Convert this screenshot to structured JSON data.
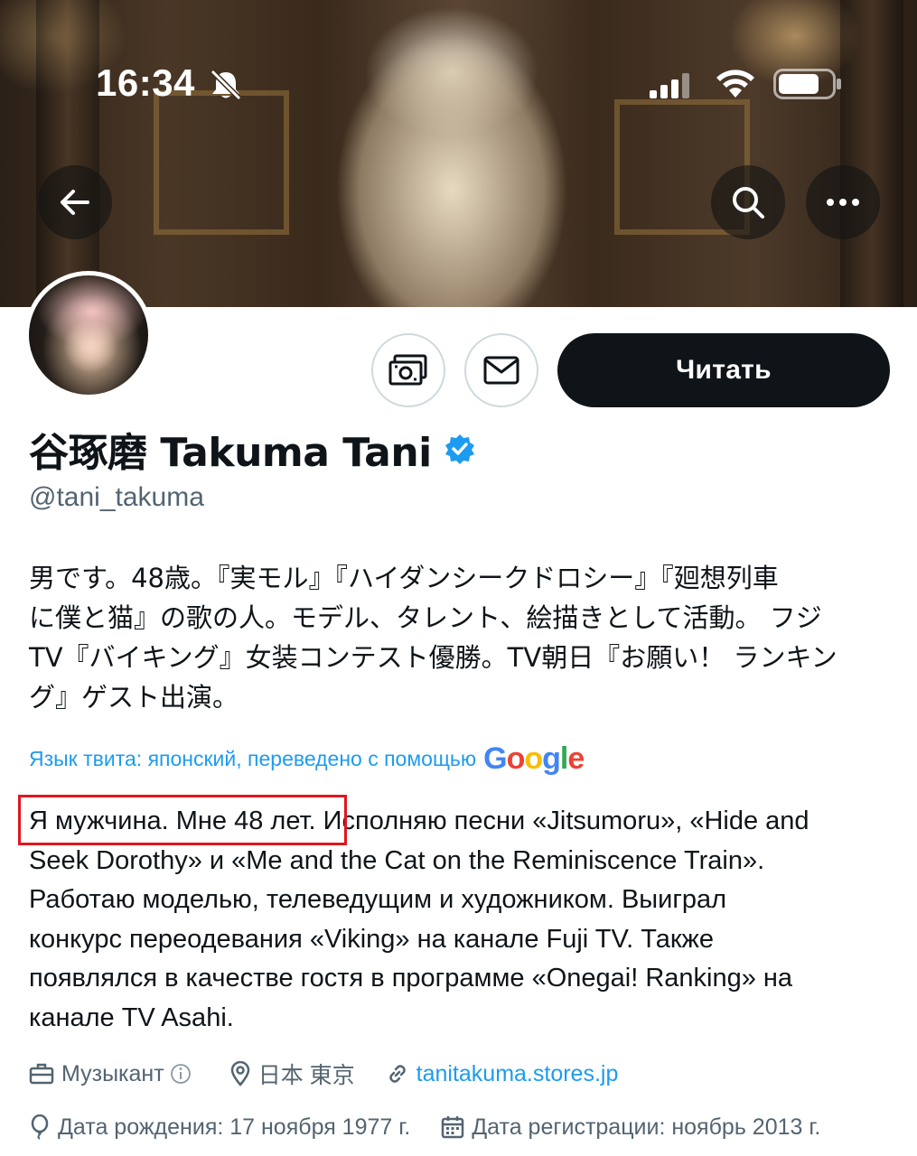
{
  "status_bar": {
    "time": "16:34",
    "icons": [
      "bell-slash-icon",
      "signal-icon",
      "wifi-icon",
      "battery-icon"
    ]
  },
  "header": {
    "back_icon": "arrow-left-icon",
    "search_icon": "search-icon",
    "more_icon": "more-horizontal-icon"
  },
  "profile": {
    "display_name": "谷琢磨 Takuma Tani",
    "handle": "@tani_takuma",
    "verified": true,
    "follow_label": "Читать",
    "tip_icon": "money-icon",
    "message_icon": "envelope-icon"
  },
  "bio": {
    "original_lines": [
      "男です。48歳。『実モル』『ハイダンシークドロシー』『廻想列車",
      "に僕と猫』の歌の人。モデル、タレント、絵描きとして活動。 フジ",
      "TV『バイキング』女装コンテスト優勝。TV朝日『お願い！ ランキン",
      "グ』ゲスト出演。"
    ],
    "translation_label": "Язык твита: японский, переведено с помощью",
    "translation_provider": "Google",
    "translated_highlight": "Я мужчина. Мне 48 лет.",
    "translated_line1_rest": " Исполняю песни «Jitsumoru», «Hide and",
    "translated_lines": [
      "Seek Dorothy» и «Me and the Cat on the Reminiscence Train».",
      "Работаю моделью, телеведущим и художником. Выиграл",
      "конкурс переодевания «Viking» на канале Fuji TV. Также",
      "появлялся в качестве гостя в программе «Onegai! Ranking» на",
      "канале TV Asahi."
    ]
  },
  "meta": {
    "category": "Музыкант",
    "location": "日本 東京",
    "website": "tanitakuma.stores.jp",
    "birthday": "Дата рождения: 17 ноября 1977 г.",
    "joined": "Дата регистрации: ноябрь 2013 г."
  },
  "colors": {
    "accent": "#1d9bf0",
    "text": "#0f1419",
    "secondary": "#536471",
    "highlight_border": "#e0161f",
    "button": "#0f1419"
  }
}
